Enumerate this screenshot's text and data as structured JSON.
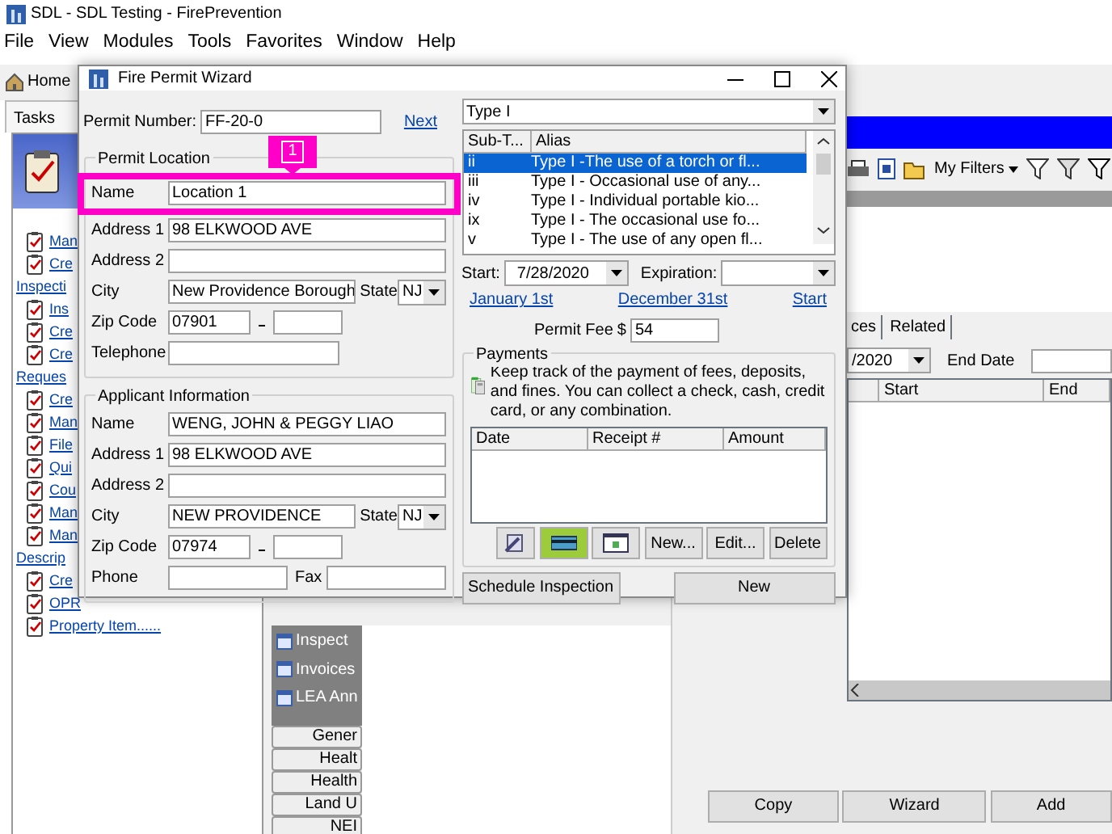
{
  "app": {
    "title": "SDL - SDL Testing - FirePrevention",
    "menu": [
      "File",
      "View",
      "Modules",
      "Tools",
      "Favorites",
      "Window",
      "Help"
    ],
    "home": "Home",
    "tasks_tab": "Tasks",
    "task_links": [
      {
        "lines": [
          "Man"
        ]
      },
      {
        "lines": [
          "Cre",
          "Inspecti"
        ]
      },
      {
        "lines": [
          "Ins"
        ]
      },
      {
        "lines": [
          "Cre"
        ]
      },
      {
        "lines": [
          "Cre",
          "Reques"
        ]
      },
      {
        "lines": [
          "Cre"
        ]
      },
      {
        "lines": [
          "Man"
        ]
      },
      {
        "lines": [
          "File"
        ]
      },
      {
        "lines": [
          "Qui"
        ]
      },
      {
        "lines": [
          "Cou"
        ]
      },
      {
        "lines": [
          "Man"
        ]
      },
      {
        "lines": [
          "Man",
          "Descrip"
        ]
      },
      {
        "lines": [
          "Cre"
        ]
      },
      {
        "lines": [
          "OPR"
        ]
      },
      {
        "lines": [
          "Property Item......"
        ]
      }
    ],
    "nav_items": [
      "Inspect",
      "Invoices",
      "LEA Ann"
    ],
    "nav_buttons": [
      "Gener",
      "Healt",
      "Health",
      "Land U",
      "NEI"
    ],
    "filters": "My Filters",
    "tabs": [
      "ces",
      "Related"
    ],
    "date_value": "/2020",
    "end_date_label": "End Date",
    "columns": [
      "Start",
      "End"
    ],
    "buttons": [
      "Copy",
      "Wizard",
      "Add"
    ]
  },
  "dialog": {
    "title": "Fire Permit Wizard",
    "permit_number_label": "Permit Number:",
    "permit_number": "FF-20-0",
    "next_link": "Next",
    "location": {
      "legend": "Permit Location",
      "rows": [
        {
          "kind": "text",
          "label": "Name",
          "value": "Location 1",
          "highlighted": true
        },
        {
          "kind": "text",
          "label": "Address 1",
          "value": "98 ELKWOOD AVE",
          "highlighted": false
        },
        {
          "kind": "text",
          "label": "Address 2",
          "highlighted": false
        },
        {
          "kind": "city",
          "label": "City",
          "value": "New Providence Borough",
          "state_label": "State",
          "state": "NJ",
          "highlighted": false
        },
        {
          "kind": "zip",
          "label": "Zip Code",
          "value": "07901",
          "highlighted": false
        },
        {
          "kind": "short",
          "label": "Telephone",
          "highlighted": false
        }
      ]
    },
    "applicant": {
      "legend": "Applicant Information",
      "rows": [
        {
          "kind": "text",
          "label": "Name",
          "value": "WENG, JOHN & PEGGY LIAO"
        },
        {
          "kind": "text",
          "label": "Address 1",
          "value": "98 ELKWOOD AVE"
        },
        {
          "kind": "text",
          "label": "Address 2"
        },
        {
          "kind": "city",
          "label": "City",
          "value": "NEW PROVIDENCE",
          "state_label": "State",
          "state": "NJ"
        },
        {
          "kind": "zip",
          "label": "Zip Code",
          "value": "07974"
        },
        {
          "kind": "phone",
          "label": "Phone",
          "fax_label": "Fax"
        }
      ]
    },
    "type": "Type I",
    "list_columns": [
      "Sub-T...",
      "Alias"
    ],
    "list_rows": [
      {
        "sub_type": "ii",
        "alias": "Type I -The use of a torch or fl...",
        "selected": true
      },
      {
        "sub_type": "iii",
        "alias": "Type I - Occasional use of any...",
        "selected": false
      },
      {
        "sub_type": "iv",
        "alias": "Type I - Individual portable kio...",
        "selected": false
      },
      {
        "sub_type": "ix",
        "alias": "Type I - The occasional use fo...",
        "selected": false
      },
      {
        "sub_type": "v",
        "alias": "Type I - The use of any open fl...",
        "selected": false
      }
    ],
    "start_label": "Start:",
    "start": "7/28/2020",
    "expiration_label": "Expiration:",
    "date_links": [
      "January 1st",
      "December 31st",
      "Start"
    ],
    "fee_label": "Permit Fee",
    "fee_currency": "$",
    "fee": "54",
    "payments": {
      "legend": "Payments",
      "description": "Keep track of the payment of fees, deposits, and fines. You can collect a check, cash, credit card, or any combination.",
      "columns": [
        "Date",
        "Receipt #",
        "Amount"
      ],
      "buttons": [
        "New...",
        "Edit...",
        "Delete"
      ]
    },
    "footer_buttons": [
      "Schedule Inspection",
      "New"
    ]
  },
  "annotation": {
    "marker": "1"
  }
}
